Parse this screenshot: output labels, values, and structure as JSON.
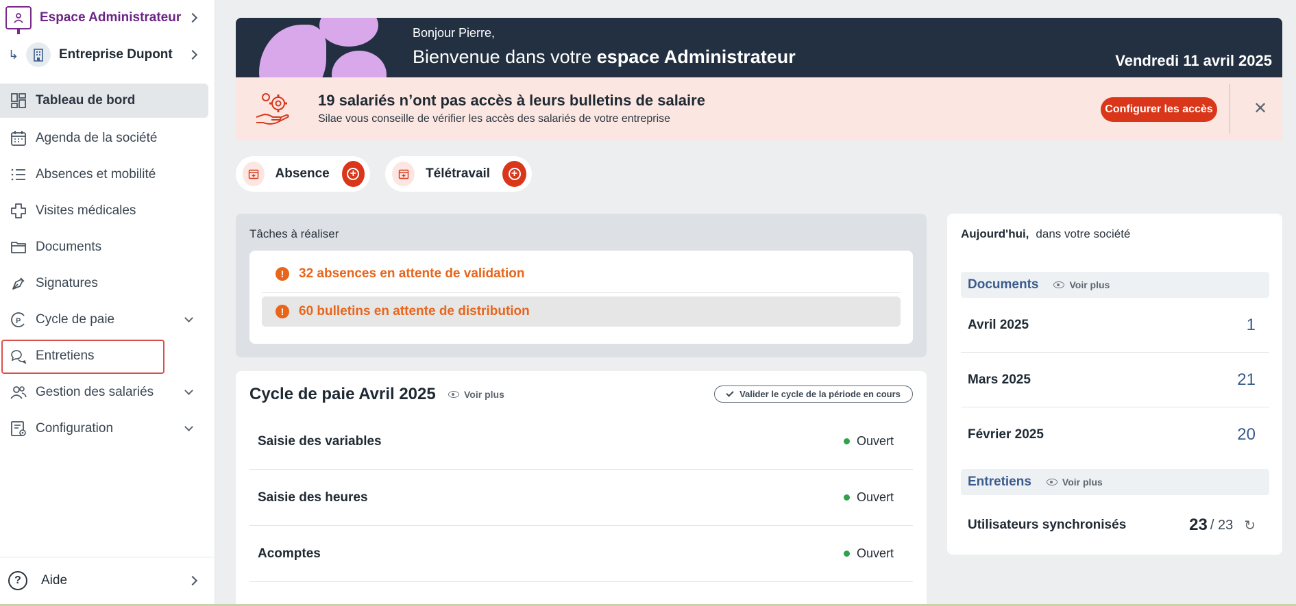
{
  "sidebar": {
    "space_title": "Espace Administrateur",
    "company_name": "Entreprise Dupont",
    "items": [
      {
        "label": "Tableau de bord"
      },
      {
        "label": "Agenda de la société"
      },
      {
        "label": "Absences et mobilité"
      },
      {
        "label": "Visites médicales"
      },
      {
        "label": "Documents"
      },
      {
        "label": "Signatures"
      },
      {
        "label": "Cycle de paie"
      },
      {
        "label": "Entretiens"
      },
      {
        "label": "Gestion des salariés"
      },
      {
        "label": "Configuration"
      }
    ],
    "help_label": "Aide"
  },
  "header": {
    "greeting": "Bonjour Pierre,",
    "welcome_prefix": "Bienvenue dans votre",
    "welcome_bold": "espace Administrateur",
    "date": "Vendredi 11 avril 2025"
  },
  "alert": {
    "title": "19 salariés n’ont pas accès à leurs bulletins de salaire",
    "subtitle": "Silae vous conseille de vérifier les accès des salariés de votre entreprise",
    "button": "Configurer les accès",
    "close": "✕"
  },
  "quick_actions": [
    {
      "label": "Absence"
    },
    {
      "label": "Télétravail"
    }
  ],
  "tasks": {
    "title": "Tâches à réaliser",
    "items": [
      {
        "text": "32 absences en attente de validation"
      },
      {
        "text": "60 bulletins en attente de distribution"
      }
    ]
  },
  "cycle": {
    "title": "Cycle de paie Avril 2025",
    "voir_plus": "Voir plus",
    "validate_label": "Valider le cycle de la période en cours",
    "rows": [
      {
        "name": "Saisie des variables",
        "status": "Ouvert"
      },
      {
        "name": "Saisie des heures",
        "status": "Ouvert"
      },
      {
        "name": "Acomptes",
        "status": "Ouvert"
      }
    ]
  },
  "today": {
    "title_bold": "Aujourd'hui,",
    "title_rest": "dans votre société",
    "documents": {
      "label": "Documents",
      "voir_plus": "Voir plus",
      "rows": [
        {
          "month": "Avril 2025",
          "count": "1"
        },
        {
          "month": "Mars 2025",
          "count": "21"
        },
        {
          "month": "Février 2025",
          "count": "20"
        }
      ]
    },
    "entretiens": {
      "label": "Entretiens",
      "voir_plus": "Voir plus",
      "sync_label": "Utilisateurs synchronisés",
      "sync_count": "23",
      "sync_total": "/ 23"
    }
  },
  "colors": {
    "accent": "#d9361a",
    "brand_purple": "#6b2584",
    "banner_bg": "#233041",
    "alert_bg": "#fbe6e1",
    "warning": "#e8651a",
    "status_open": "#2fa24a",
    "link_blue": "#3b5b8c"
  },
  "icons": {
    "space": "monitor-user-icon",
    "company": "building-icon",
    "nav": [
      "dashboard-icon",
      "calendar-icon",
      "list-icon",
      "medical-cross-icon",
      "folder-icon",
      "pen-icon",
      "payroll-icon",
      "chat-bubbles-icon",
      "users-icon",
      "settings-doc-icon"
    ],
    "help": "question-circle-icon"
  }
}
